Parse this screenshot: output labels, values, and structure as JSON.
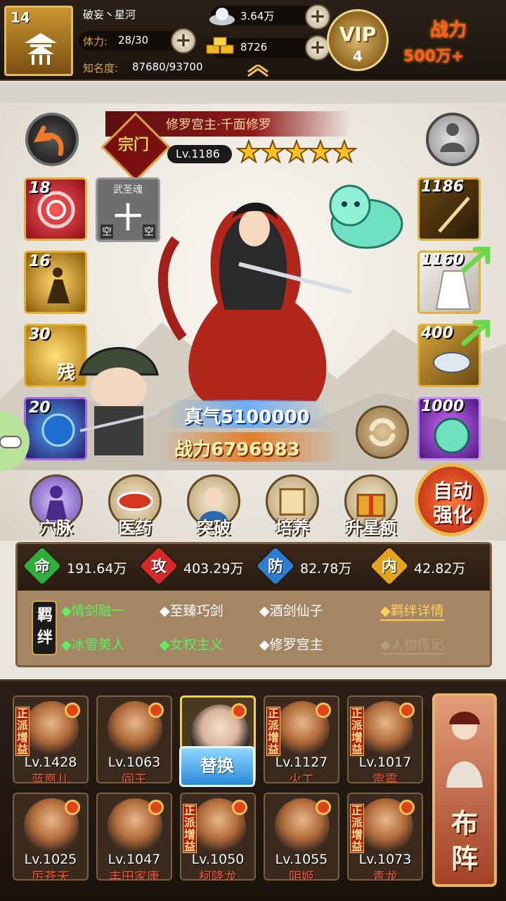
{
  "player": {
    "level": "14",
    "name": "破妄丶星河",
    "stamina_label": "体力:",
    "stamina": "28/30",
    "fame_label": "知名度:",
    "fame": "87680/93700"
  },
  "currency": {
    "silver": "3.64万",
    "gold": "8726"
  },
  "vip": {
    "label": "VIP",
    "level": "4"
  },
  "power_top": {
    "label": "战力",
    "value": "500万+"
  },
  "hero": {
    "title": "修罗宫主·千面修罗",
    "level": "Lv.1186",
    "stars": 5,
    "badge": "宗门"
  },
  "skills": [
    {
      "level": "18"
    },
    {
      "level": "16"
    },
    {
      "level": "30",
      "glyph": "残"
    },
    {
      "level": "20"
    }
  ],
  "soul": {
    "label": "武圣魂",
    "glyph": "十",
    "slot_a": "空",
    "slot_b": "空"
  },
  "equips": [
    {
      "level": "1186"
    },
    {
      "level": "1160"
    },
    {
      "level": "400"
    },
    {
      "level": "1000"
    }
  ],
  "zhenqi": "真气5100000",
  "hero_power": "战力6796983",
  "menu": [
    "穴脉",
    "医药",
    "突破",
    "培养",
    "升星额外"
  ],
  "auto_strengthen": "自动强化",
  "stats": [
    {
      "icon": "命",
      "value": "191.64万",
      "color": "#2fae3a"
    },
    {
      "icon": "攻",
      "value": "403.29万",
      "color": "#d42a2a"
    },
    {
      "icon": "防",
      "value": "82.78万",
      "color": "#2a7ed4"
    },
    {
      "icon": "内",
      "value": "42.82万",
      "color": "#e3a51c"
    }
  ],
  "bonds_label": "羁绊",
  "bonds": [
    "◆情剑融一",
    "◆至臻巧剑",
    "◆酒剑仙子",
    "◆冰雪美人",
    "◆女权主义",
    "◆修罗宫主"
  ],
  "bond_detail": "◆羁绊详情",
  "bio": "◆人物传记",
  "team_row1": [
    {
      "level": "Lv.1428",
      "name": "蓝凰儿",
      "tag": "正派增益"
    },
    {
      "level": "Lv.1063",
      "name": "阎王",
      "tag": ""
    },
    {
      "level": "",
      "name": "",
      "tag": ""
    },
    {
      "level": "Lv.1127",
      "name": "火工",
      "tag": "正派增益"
    },
    {
      "level": "Lv.1017",
      "name": "雷震",
      "tag": "正派增益"
    }
  ],
  "team_row2": [
    {
      "level": "Lv.1025",
      "name": "厉苍天",
      "tag": ""
    },
    {
      "level": "Lv.1047",
      "name": "丰田家康",
      "tag": ""
    },
    {
      "level": "Lv.1050",
      "name": "柯降龙",
      "tag": "正派增益"
    },
    {
      "level": "Lv.1055",
      "name": "阴姬",
      "tag": ""
    },
    {
      "level": "Lv.1073",
      "name": "青龙",
      "tag": "正派增益"
    }
  ],
  "swap_label": "替换",
  "formation": "布阵"
}
